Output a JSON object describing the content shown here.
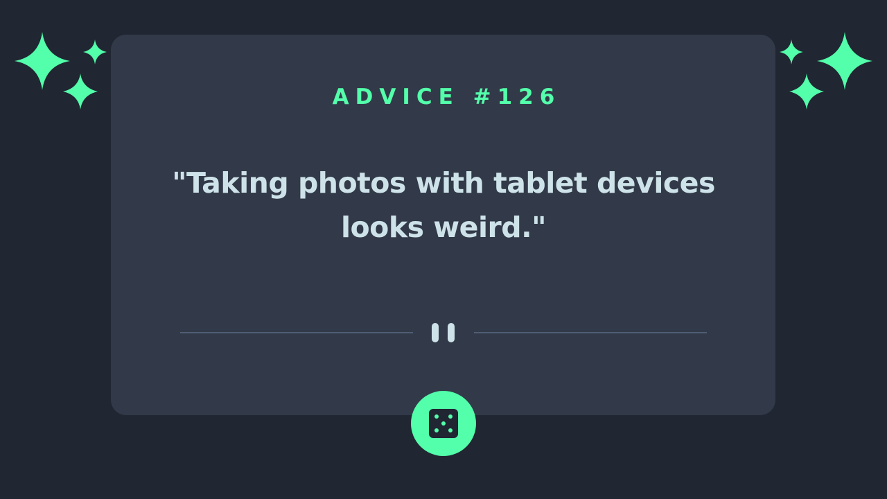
{
  "advice": {
    "heading": "ADVICE #126",
    "quote": "\"Taking photos with tablet devices looks weird.\""
  },
  "icons": {
    "divider": "pause-icon",
    "button": "dice-icon",
    "decoration": "sparkles-icon"
  },
  "colors": {
    "background": "#202632",
    "card": "#323a49",
    "accent": "#53ffaa",
    "text": "#cee3e9",
    "divider": "#4f5d74"
  }
}
